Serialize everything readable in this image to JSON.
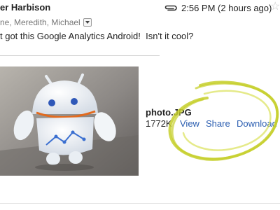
{
  "email": {
    "sender": "er Harbison",
    "timestamp": "2:56 PM (2 hours ago)",
    "recipients": "ne, Meredith, Michael",
    "body": "t got this Google Analytics Android!  Isn't it cool?"
  },
  "attachment": {
    "filename": "photo.JPG",
    "size": "1772K",
    "view_label": "View",
    "share_label": "Share",
    "download_label": "Download"
  },
  "icons": {
    "attachment": "paperclip-icon",
    "star": "star-icon",
    "details_toggle": "chevron-down-icon"
  },
  "colors": {
    "link": "#2a5db0",
    "highlight": "#c6cf2a"
  }
}
